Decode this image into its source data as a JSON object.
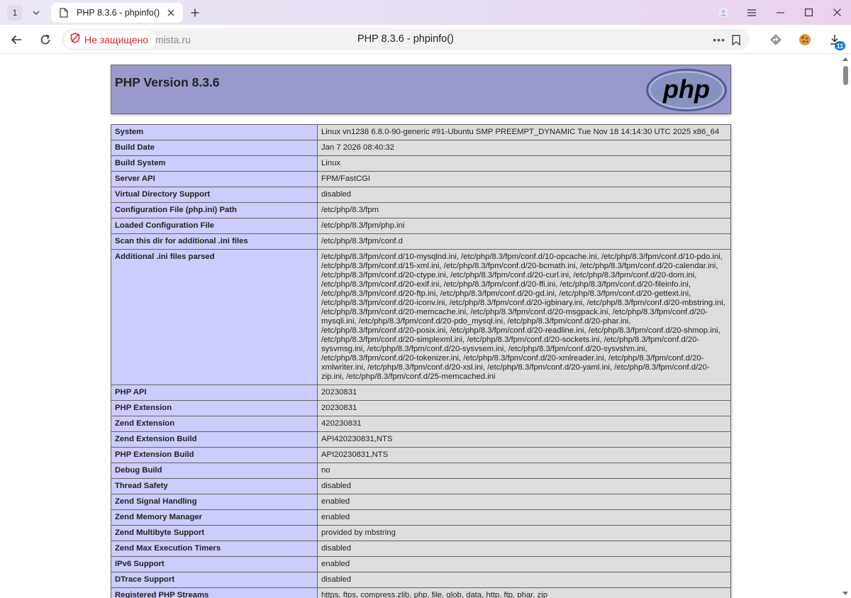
{
  "browser": {
    "tab_count": "1",
    "tab_title": "PHP 8.3.6 - phpinfo()",
    "security_label": "Не защищено",
    "domain": "mista.ru",
    "page_title": "PHP 8.3.6 - phpinfo()",
    "downloads_badge": "11"
  },
  "phpinfo": {
    "heading": "PHP Version 8.3.6",
    "logo_text": "php",
    "rows": [
      {
        "key": "System",
        "value": "Linux vn1238 6.8.0-90-generic #91-Ubuntu SMP PREEMPT_DYNAMIC Tue Nov 18 14:14:30 UTC 2025 x86_64"
      },
      {
        "key": "Build Date",
        "value": "Jan 7 2026 08:40:32"
      },
      {
        "key": "Build System",
        "value": "Linux"
      },
      {
        "key": "Server API",
        "value": "FPM/FastCGI"
      },
      {
        "key": "Virtual Directory Support",
        "value": "disabled"
      },
      {
        "key": "Configuration File (php.ini) Path",
        "value": "/etc/php/8.3/fpm"
      },
      {
        "key": "Loaded Configuration File",
        "value": "/etc/php/8.3/fpm/php.ini"
      },
      {
        "key": "Scan this dir for additional .ini files",
        "value": "/etc/php/8.3/fpm/conf.d"
      },
      {
        "key": "Additional .ini files parsed",
        "value": "/etc/php/8.3/fpm/conf.d/10-mysqlnd.ini, /etc/php/8.3/fpm/conf.d/10-opcache.ini, /etc/php/8.3/fpm/conf.d/10-pdo.ini, /etc/php/8.3/fpm/conf.d/15-xml.ini, /etc/php/8.3/fpm/conf.d/20-bcmath.ini, /etc/php/8.3/fpm/conf.d/20-calendar.ini, /etc/php/8.3/fpm/conf.d/20-ctype.ini, /etc/php/8.3/fpm/conf.d/20-curl.ini, /etc/php/8.3/fpm/conf.d/20-dom.ini, /etc/php/8.3/fpm/conf.d/20-exif.ini, /etc/php/8.3/fpm/conf.d/20-ffi.ini, /etc/php/8.3/fpm/conf.d/20-fileinfo.ini, /etc/php/8.3/fpm/conf.d/20-ftp.ini, /etc/php/8.3/fpm/conf.d/20-gd.ini, /etc/php/8.3/fpm/conf.d/20-gettext.ini, /etc/php/8.3/fpm/conf.d/20-iconv.ini, /etc/php/8.3/fpm/conf.d/20-igbinary.ini, /etc/php/8.3/fpm/conf.d/20-mbstring.ini, /etc/php/8.3/fpm/conf.d/20-memcache.ini, /etc/php/8.3/fpm/conf.d/20-msgpack.ini, /etc/php/8.3/fpm/conf.d/20-mysqli.ini, /etc/php/8.3/fpm/conf.d/20-pdo_mysql.ini, /etc/php/8.3/fpm/conf.d/20-phar.ini, /etc/php/8.3/fpm/conf.d/20-posix.ini, /etc/php/8.3/fpm/conf.d/20-readline.ini, /etc/php/8.3/fpm/conf.d/20-shmop.ini, /etc/php/8.3/fpm/conf.d/20-simplexml.ini, /etc/php/8.3/fpm/conf.d/20-sockets.ini, /etc/php/8.3/fpm/conf.d/20-sysvmsg.ini, /etc/php/8.3/fpm/conf.d/20-sysvsem.ini, /etc/php/8.3/fpm/conf.d/20-sysvshm.ini, /etc/php/8.3/fpm/conf.d/20-tokenizer.ini, /etc/php/8.3/fpm/conf.d/20-xmlreader.ini, /etc/php/8.3/fpm/conf.d/20-xmlwriter.ini, /etc/php/8.3/fpm/conf.d/20-xsl.ini, /etc/php/8.3/fpm/conf.d/20-yaml.ini, /etc/php/8.3/fpm/conf.d/20-zip.ini, /etc/php/8.3/fpm/conf.d/25-memcached.ini"
      },
      {
        "key": "PHP API",
        "value": "20230831"
      },
      {
        "key": "PHP Extension",
        "value": "20230831"
      },
      {
        "key": "Zend Extension",
        "value": "420230831"
      },
      {
        "key": "Zend Extension Build",
        "value": "API420230831,NTS"
      },
      {
        "key": "PHP Extension Build",
        "value": "API20230831,NTS"
      },
      {
        "key": "Debug Build",
        "value": "no"
      },
      {
        "key": "Thread Safety",
        "value": "disabled"
      },
      {
        "key": "Zend Signal Handling",
        "value": "enabled"
      },
      {
        "key": "Zend Memory Manager",
        "value": "enabled"
      },
      {
        "key": "Zend Multibyte Support",
        "value": "provided by mbstring"
      },
      {
        "key": "Zend Max Execution Timers",
        "value": "disabled"
      },
      {
        "key": "IPv6 Support",
        "value": "enabled"
      },
      {
        "key": "DTrace Support",
        "value": "disabled"
      },
      {
        "key": "Registered PHP Streams",
        "value": "https, ftps, compress.zlib, php, file, glob, data, http, ftp, phar, zip"
      }
    ]
  },
  "colors": {
    "header_bg": "#9999cc",
    "key_cell_bg": "#ccccff",
    "value_cell_bg": "#dddddd",
    "insecure_red": "#d3282f"
  }
}
